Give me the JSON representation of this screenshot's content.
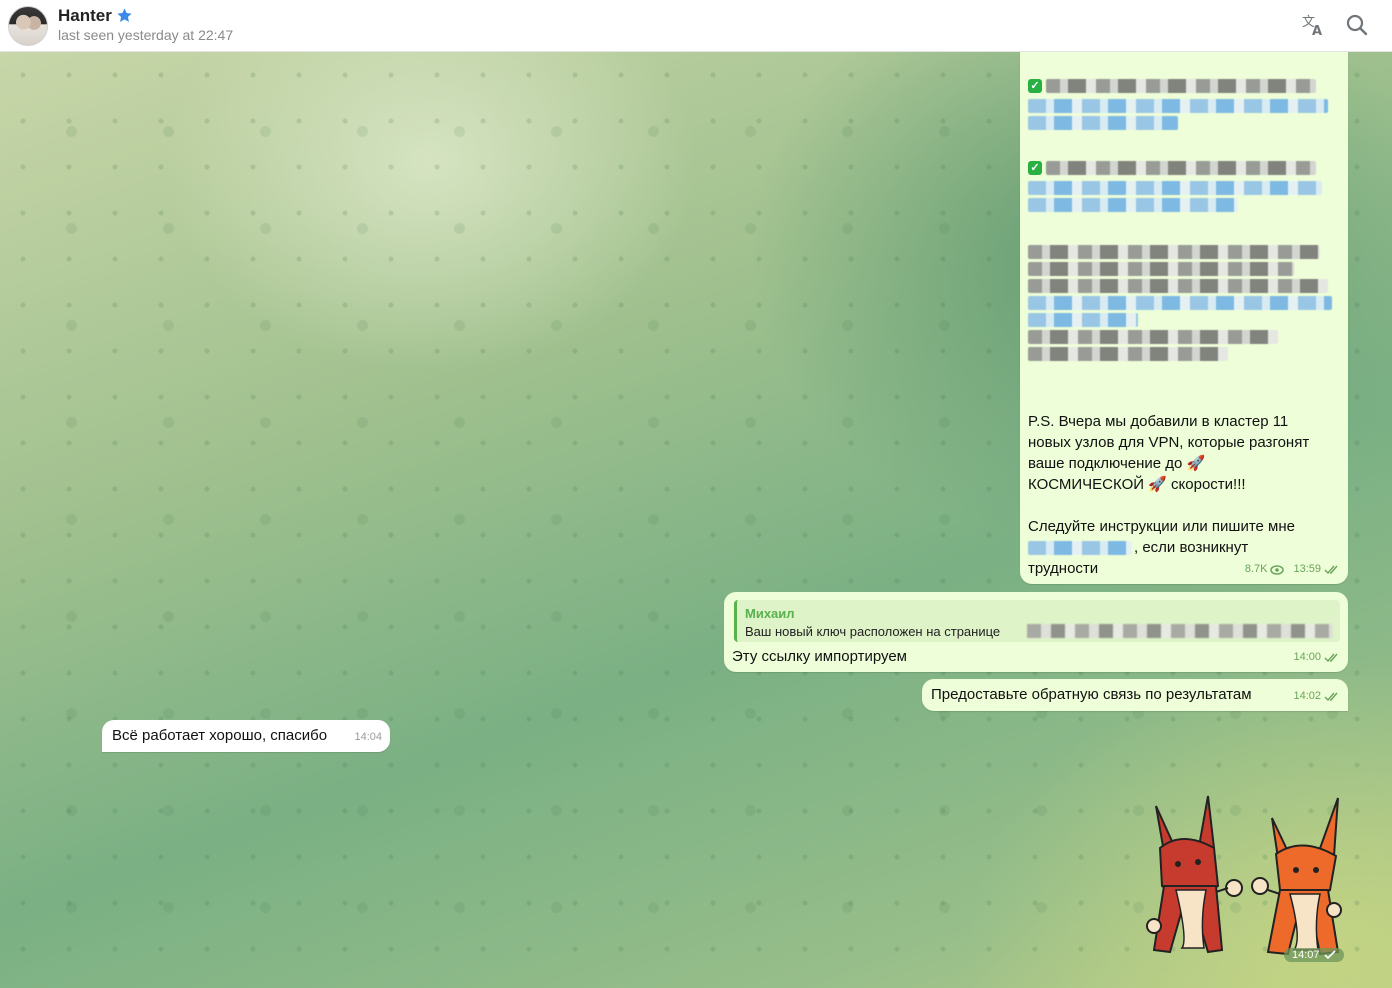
{
  "header": {
    "title": "Hanter",
    "status": "last seen yesterday at 22:47"
  },
  "messages": {
    "ps_text_1": "P.S. Вчера мы добавили в кластер 11",
    "ps_text_2": "новых узлов для VPN, которые разгонят",
    "ps_text_3": "ваше подключение до 🚀",
    "ps_text_4": " КОСМИЧЕСКОЙ 🚀 скорости!!!",
    "follow_1": "Следуйте инструкции или пишите мне",
    "follow_2_suffix": ", если возникнут",
    "follow_3": "трудности",
    "channel_views": "8.7K",
    "channel_time": "13:59",
    "reply_author": "Михаил",
    "reply_text": "Ваш новый ключ расположен на странице",
    "import_text": "Эту ссылку импортируем",
    "import_time": "14:00",
    "feedback_text": "Предоставьте обратную связь по результатам",
    "feedback_time": "14:02",
    "incoming_text": "Всё работает хорошо, спасибо",
    "incoming_time": "14:04",
    "sticker_time": "14:07"
  },
  "colors": {
    "out_bubble": "#eefed8",
    "in_bubble": "#ffffff",
    "accent_green": "#58b24e",
    "link_blue": "#3390ec"
  },
  "icons": [
    "verified-star-icon",
    "translate-icon",
    "search-icon",
    "views-eye-icon",
    "double-check-icon",
    "single-check-icon",
    "rocket-emoji",
    "green-check-emoji"
  ]
}
